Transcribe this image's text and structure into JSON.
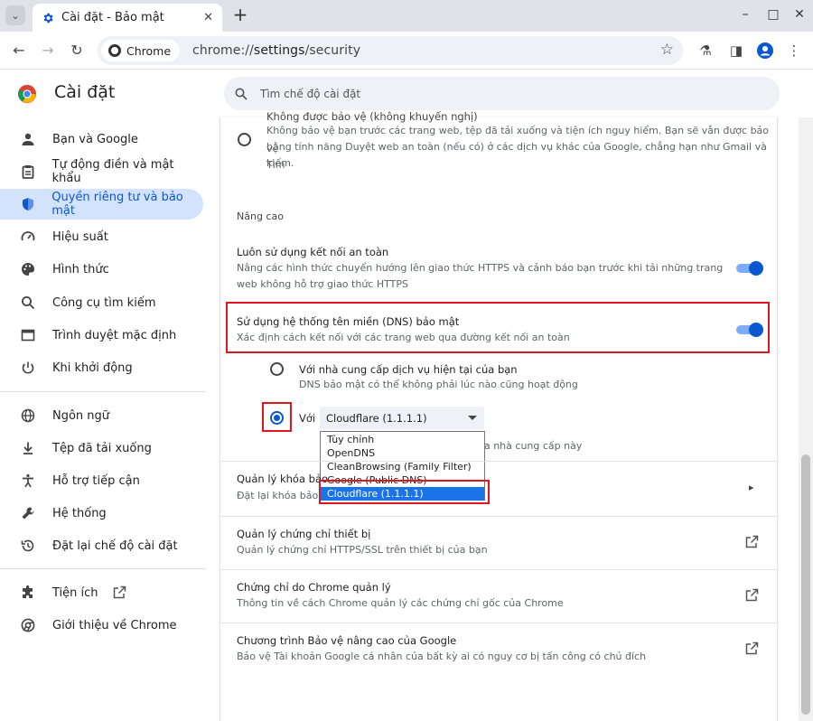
{
  "tab": {
    "title": "Cài đặt - Bảo mật",
    "close": "✕"
  },
  "toolbar": {
    "chip_label": "Chrome",
    "url_scheme": "chrome://",
    "url_path": "settings",
    "url_rest": "/security"
  },
  "header": {
    "title": "Cài đặt",
    "search_placeholder": "Tìm chế độ cài đặt"
  },
  "sidebar": {
    "items": [
      {
        "label": "Bạn và Google",
        "icon": "person-icon"
      },
      {
        "label": "Tự động điền và mật khẩu",
        "icon": "clipboard-icon"
      },
      {
        "label": "Quyền riêng tư và bảo mật",
        "icon": "shield-icon"
      },
      {
        "label": "Hiệu suất",
        "icon": "speedometer-icon"
      },
      {
        "label": "Hình thức",
        "icon": "palette-icon"
      },
      {
        "label": "Công cụ tìm kiếm",
        "icon": "search-icon"
      },
      {
        "label": "Trình duyệt mặc định",
        "icon": "browser-icon"
      },
      {
        "label": "Khi khởi động",
        "icon": "power-icon"
      },
      {
        "label": "Ngôn ngữ",
        "icon": "globe-icon"
      },
      {
        "label": "Tệp đã tải xuống",
        "icon": "download-icon"
      },
      {
        "label": "Hỗ trợ tiếp cận",
        "icon": "accessibility-icon"
      },
      {
        "label": "Hệ thống",
        "icon": "wrench-icon"
      },
      {
        "label": "Đặt lại chế độ cài đặt",
        "icon": "history-icon"
      },
      {
        "label": "Tiện ích",
        "icon": "puzzle-icon"
      },
      {
        "label": "Giới thiệu về Chrome",
        "icon": "chrome-icon"
      }
    ]
  },
  "main": {
    "no_protection": {
      "title_partial": "Không được bảo vệ (không khuyến nghị)",
      "desc_line1": "Không bảo vệ bạn trước các trang web, tệp đã tải xuống và tiện ích nguy hiểm. Bạn sẽ vẫn được bảo vệ",
      "desc_line2": "bằng tính năng Duyệt web an toàn (nếu có) ở các dịch vụ khác của Google, chẳng hạn như Gmail và Tìm",
      "desc_line3": "kiếm."
    },
    "advanced_heading": "Nâng cao",
    "https": {
      "title": "Luôn sử dụng kết nối an toàn",
      "desc_line1": "Nâng các hình thức chuyển hướng lên giao thức HTTPS và cảnh báo bạn trước khi tải những trang",
      "desc_line2": "web không hỗ trợ giao thức HTTPS"
    },
    "dns": {
      "title": "Sử dụng hệ thống tên miền (DNS) bảo mật",
      "desc": "Xác định cách kết nối với các trang web qua đường kết nối an toàn",
      "opt_current_title": "Với nhà cung cấp dịch vụ hiện tại của bạn",
      "opt_current_desc": "DNS bảo mật có thể không phải lúc nào cũng hoạt động",
      "opt_custom_prefix": "Với",
      "select_value": "Cloudflare (1.1.1.1)",
      "behind_text": "ủa nhà cung cấp này",
      "options": [
        "Tùy chỉnh",
        "OpenDNS",
        "CleanBrowsing (Family Filter)",
        "Google (Public DNS)",
        "Cloudflare (1.1.1.1)"
      ]
    },
    "manage_keys": {
      "title": "Quản lý khóa bảo",
      "desc": "Đặt lại khóa bảo"
    },
    "manage_certs": {
      "title": "Quản lý chứng chỉ thiết bị",
      "desc": "Quản lý chứng chỉ HTTPS/SSL trên thiết bị của bạn"
    },
    "chrome_certs": {
      "title": "Chứng chỉ do Chrome quản lý",
      "desc": "Thông tin về cách Chrome quản lý các chứng chỉ gốc của Chrome"
    },
    "advanced_protection": {
      "title": "Chương trình Bảo vệ nâng cao của Google",
      "desc": "Bảo vệ Tài khoản Google cá nhân của bất kỳ ai có nguy cơ bị tấn công có chủ đích"
    }
  }
}
